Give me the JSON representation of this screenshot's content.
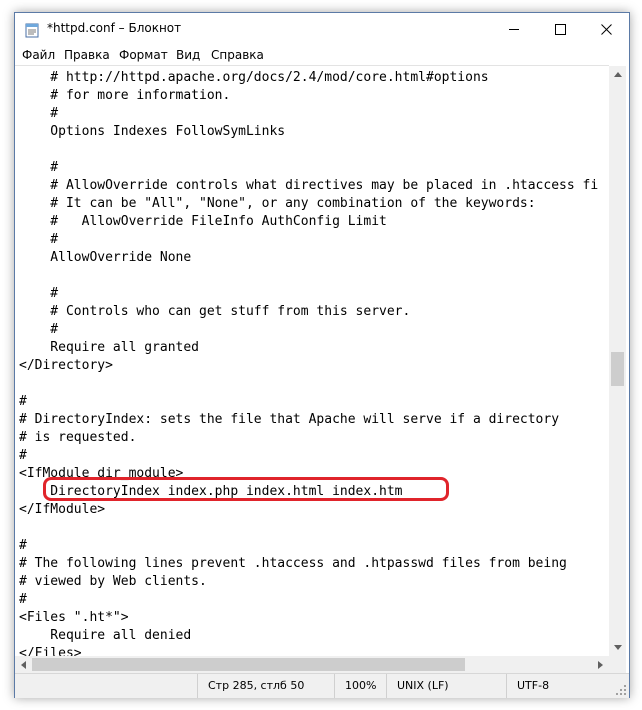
{
  "window": {
    "title": "*httpd.conf – Блокнот"
  },
  "menu": {
    "items": [
      "Файл",
      "Правка",
      "Формат",
      "Вид",
      "Справка"
    ]
  },
  "editor": {
    "lines": [
      "    # http://httpd.apache.org/docs/2.4/mod/core.html#options",
      "    # for more information.",
      "    #",
      "    Options Indexes FollowSymLinks",
      "",
      "    #",
      "    # AllowOverride controls what directives may be placed in .htaccess fi",
      "    # It can be \"All\", \"None\", or any combination of the keywords:",
      "    #   AllowOverride FileInfo AuthConfig Limit",
      "    #",
      "    AllowOverride None",
      "",
      "    #",
      "    # Controls who can get stuff from this server.",
      "    #",
      "    Require all granted",
      "</Directory>",
      "",
      "#",
      "# DirectoryIndex: sets the file that Apache will serve if a directory",
      "# is requested.",
      "#",
      "<IfModule dir_module>",
      "    DirectoryIndex index.php index.html index.htm",
      "</IfModule>",
      "",
      "#",
      "# The following lines prevent .htaccess and .htpasswd files from being",
      "# viewed by Web clients.",
      "#",
      "<Files \".ht*\">",
      "    Require all denied",
      "</Files>"
    ]
  },
  "status": {
    "position": "Стр 285, стлб 50",
    "zoom": "100%",
    "line_endings": "UNIX (LF)",
    "encoding": "UTF-8"
  },
  "colors": {
    "highlight": "#e0242b"
  }
}
